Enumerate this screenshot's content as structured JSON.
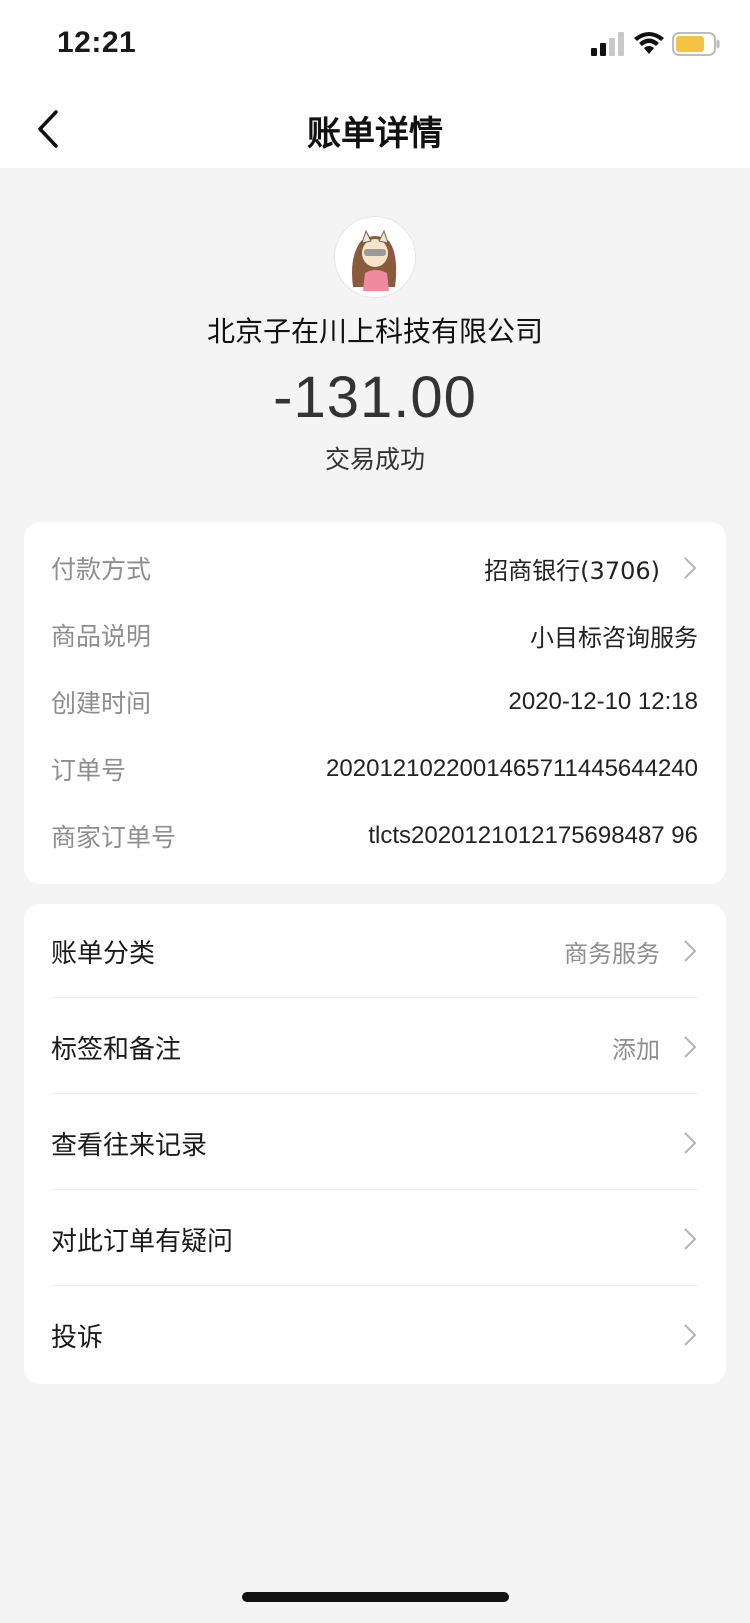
{
  "status_bar": {
    "time": "12:21"
  },
  "nav": {
    "title": "账单详情",
    "back_icon": "chevron-left-icon"
  },
  "header": {
    "merchant_name": "北京子在川上科技有限公司",
    "amount": "-131.00",
    "status": "交易成功"
  },
  "details": {
    "payment_method": {
      "label": "付款方式",
      "value": "招商银行(3706)"
    },
    "product_desc": {
      "label": "商品说明",
      "value": "小目标咨询服务"
    },
    "created_time": {
      "label": "创建时间",
      "value": "2020-12-10 12:18"
    },
    "order_no": {
      "label": "订单号",
      "value": "2020121022001465711445644240"
    },
    "merchant_order_no": {
      "label": "商家订单号",
      "value": "tlcts2020121012175698487 96"
    }
  },
  "actions": {
    "category": {
      "label": "账单分类",
      "value": "商务服务"
    },
    "tags": {
      "label": "标签和备注",
      "value": "添加"
    },
    "history": {
      "label": "查看往来记录"
    },
    "question": {
      "label": "对此订单有疑问"
    },
    "complaint": {
      "label": "投诉"
    }
  },
  "colors": {
    "battery": "#f5c343",
    "page_bg": "#f4f4f4",
    "card_bg": "#ffffff",
    "muted_text": "#8e8e8e"
  }
}
